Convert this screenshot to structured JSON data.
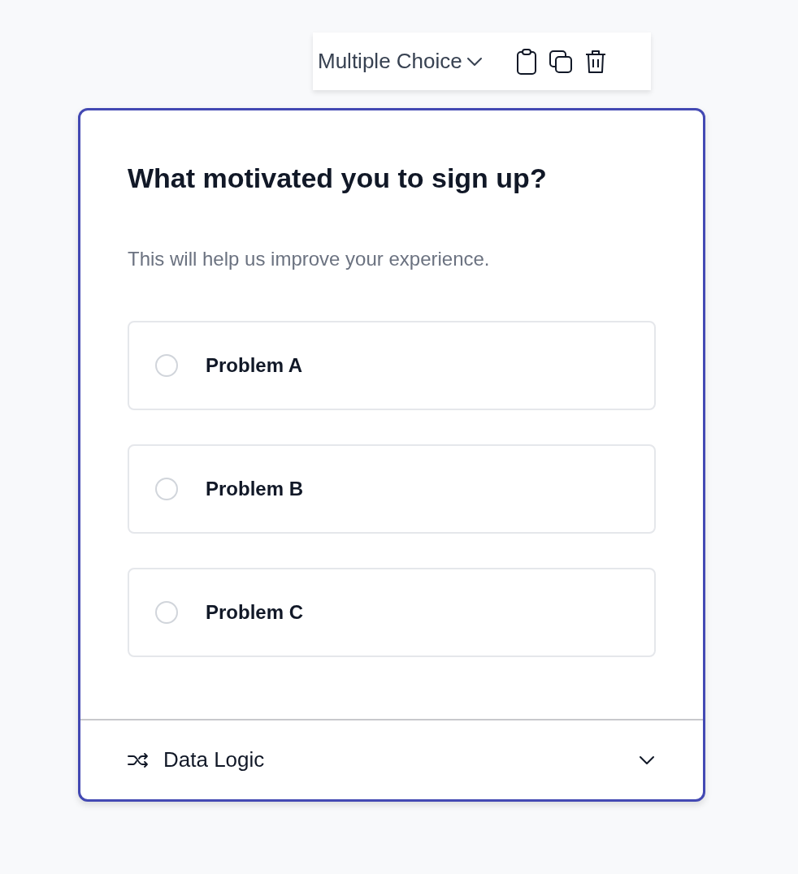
{
  "toolbar": {
    "question_type": "Multiple Choice"
  },
  "question": {
    "title": "What motivated you to sign up?",
    "description": "This will help us improve your experience."
  },
  "options": [
    {
      "label": "Problem A",
      "selected": false
    },
    {
      "label": "Problem B",
      "selected": false
    },
    {
      "label": "Problem C",
      "selected": false
    }
  ],
  "footer": {
    "label": "Data Logic",
    "expanded": false
  }
}
